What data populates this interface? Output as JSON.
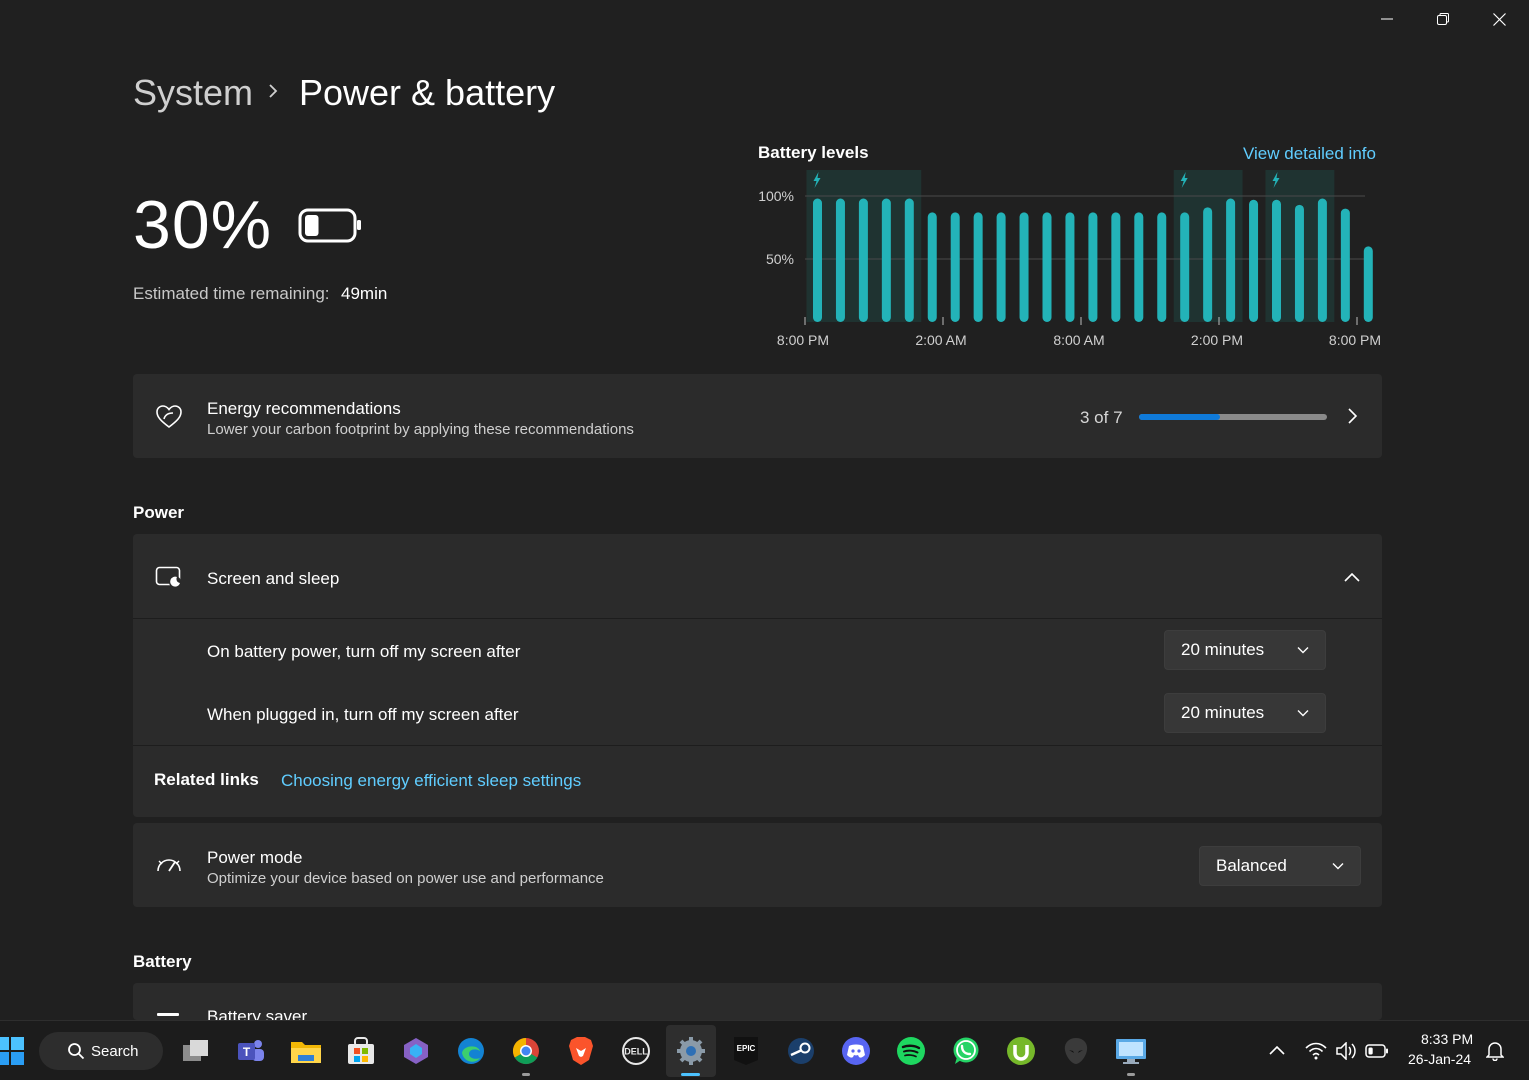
{
  "window_controls": {
    "minimize_icon": "minimize-icon",
    "restore_icon": "restore-icon",
    "close_icon": "close-icon"
  },
  "breadcrumb": {
    "parent": "System",
    "current": "Power & battery"
  },
  "battery": {
    "percent": "30%",
    "level": 0.3,
    "estimated_label": "Estimated time remaining:",
    "estimated_value": "49min"
  },
  "chart_data": {
    "type": "bar",
    "title": "Battery levels",
    "link_text": "View detailed info",
    "y_ticks": [
      "100%",
      "50%"
    ],
    "ylim": [
      0,
      100
    ],
    "x_ticks": [
      "8:00 PM",
      "2:00 AM",
      "8:00 AM",
      "2:00 PM",
      "8:00 PM"
    ],
    "values": [
      98,
      98,
      98,
      98,
      98,
      87,
      87,
      87,
      87,
      87,
      87,
      87,
      87,
      87,
      87,
      87,
      87,
      91,
      98,
      97,
      97,
      93,
      98,
      90,
      60
    ],
    "charging": [
      true,
      true,
      true,
      true,
      true,
      false,
      false,
      false,
      false,
      false,
      false,
      false,
      false,
      false,
      false,
      false,
      true,
      true,
      true,
      false,
      true,
      true,
      true,
      false,
      false
    ],
    "charging_markers": [
      0,
      16,
      20
    ],
    "bar_color": "#23b3b8",
    "charging_band_color": "#1f3331"
  },
  "energy": {
    "title": "Energy recommendations",
    "subtitle": "Lower your carbon footprint by applying these recommendations",
    "progress_text": "3 of 7",
    "progress": 0.43,
    "accent": "#0f7ad9"
  },
  "power_section": {
    "heading": "Power",
    "screen_sleep": {
      "title": "Screen and sleep",
      "battery_label": "On battery power, turn off my screen after",
      "battery_value": "20 minutes",
      "plugged_label": "When plugged in, turn off my screen after",
      "plugged_value": "20 minutes"
    },
    "related": {
      "label": "Related links",
      "link": "Choosing energy efficient sleep settings"
    },
    "power_mode": {
      "title": "Power mode",
      "subtitle": "Optimize your device based on power use and performance",
      "value": "Balanced"
    }
  },
  "battery_section": {
    "heading": "Battery",
    "saver_title": "Battery saver"
  },
  "taskbar": {
    "search_label": "Search",
    "apps": [
      "start",
      "task-view",
      "teams",
      "file-explorer",
      "microsoft-store",
      "copilot",
      "edge",
      "chrome",
      "brave",
      "dell",
      "settings",
      "epic-games",
      "steam",
      "discord",
      "spotify",
      "whatsapp",
      "utorrent",
      "alienware",
      "remote-desktop"
    ],
    "time": "8:33 PM",
    "date": "26-Jan-24",
    "epic_text": "EPIC"
  }
}
